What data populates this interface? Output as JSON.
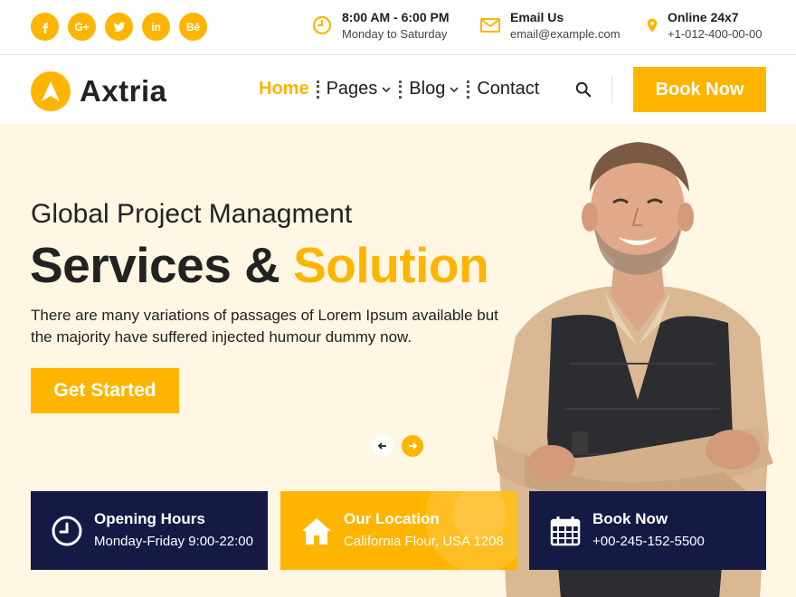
{
  "topbar": {
    "social": [
      "facebook-icon",
      "google-plus-icon",
      "twitter-icon",
      "linkedin-icon",
      "behance-icon"
    ],
    "hours": {
      "title": "8:00 AM - 6:00 PM",
      "text": "Monday to Saturday"
    },
    "email": {
      "title": "Email Us",
      "text": "email@example.com"
    },
    "phone": {
      "title": "Online 24x7",
      "text": "+1-012-400-00-00"
    }
  },
  "brand": {
    "name": "Axtria"
  },
  "nav": {
    "items": [
      {
        "label": "Home",
        "active": true
      },
      {
        "label": "Pages",
        "dropdown": true
      },
      {
        "label": "Blog",
        "dropdown": true
      },
      {
        "label": "Contact"
      }
    ],
    "cta": "Book Now"
  },
  "hero": {
    "subtitle": "Global Project Managment",
    "title_main": "Services & ",
    "title_accent": "Solution",
    "description": "There are many variations of passages of Lorem Ipsum available but the majority have suffered injected humour dummy now.",
    "cta": "Get Started"
  },
  "features": [
    {
      "icon": "clock-icon",
      "title": "Opening Hours",
      "text": "Monday-Friday 9:00-22:00"
    },
    {
      "icon": "home-icon",
      "title": "Our Location",
      "text": "California Flour, USA 1208"
    },
    {
      "icon": "calendar-icon",
      "title": "Book Now",
      "text": "+00-245-152-5500"
    }
  ],
  "colors": {
    "accent": "#ffb400",
    "dark": "#141a44",
    "hero_bg": "#fff6e3"
  }
}
